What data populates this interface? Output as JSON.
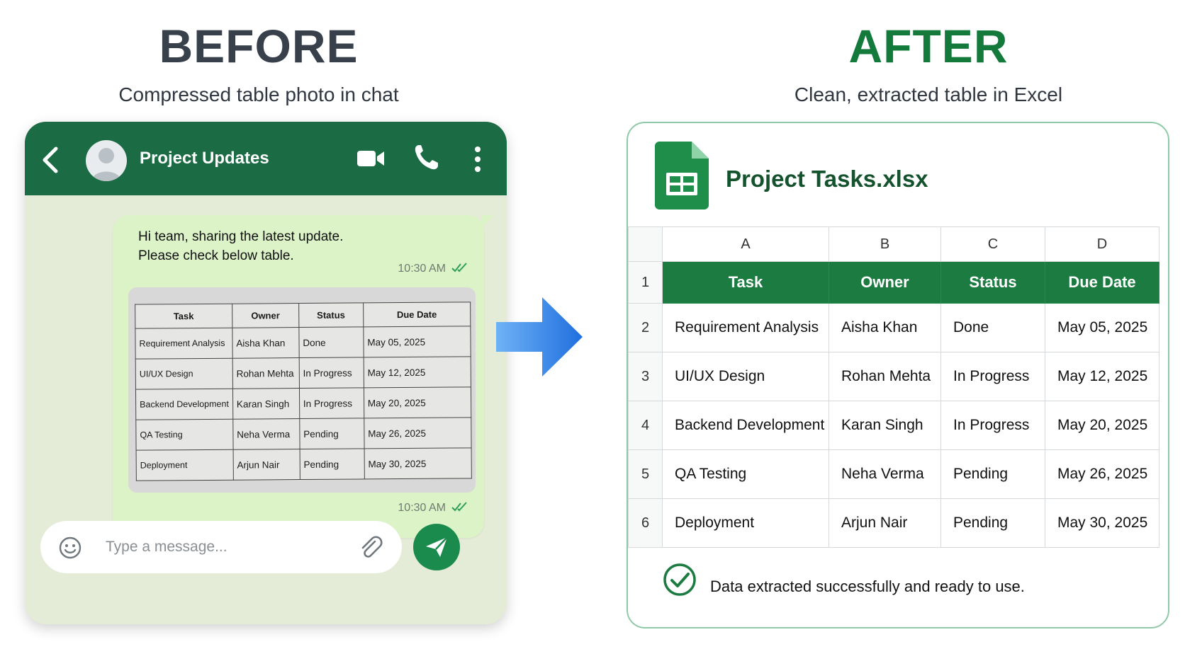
{
  "before": {
    "title": "BEFORE",
    "subtitle": "Compressed table photo in chat"
  },
  "after": {
    "title": "AFTER",
    "subtitle": "Clean, extracted table in Excel"
  },
  "chat": {
    "header_title": "Project Updates",
    "message_lines": [
      "Hi team, sharing the latest update.",
      "Please check below table."
    ],
    "message_time": "10:30 AM",
    "photo_time": "10:30 AM",
    "input_placeholder": "Type a message...",
    "colors": {
      "header": "#1b6b45",
      "bubble": "#dcf3c8",
      "background": "#e4ebd6",
      "send": "#1b8a4d"
    },
    "icons": [
      "back-arrow-icon",
      "avatar-icon",
      "video-call-icon",
      "phone-call-icon",
      "more-vertical-icon",
      "double-check-icon",
      "emoji-icon",
      "paperclip-icon",
      "send-icon"
    ]
  },
  "photo_table": {
    "headers": [
      "Task",
      "Owner",
      "Status",
      "Due Date"
    ],
    "rows": [
      [
        "Requirement Analysis",
        "Aisha Khan",
        "Done",
        "May 05, 2025"
      ],
      [
        "UI/UX Design",
        "Rohan Mehta",
        "In Progress",
        "May 12, 2025"
      ],
      [
        "Backend Development",
        "Karan Singh",
        "In Progress",
        "May 20, 2025"
      ],
      [
        "QA Testing",
        "Neha Verma",
        "Pending",
        "May 26, 2025"
      ],
      [
        "Deployment",
        "Arjun Nair",
        "Pending",
        "May 30, 2025"
      ]
    ]
  },
  "excel": {
    "file_name": "Project Tasks.xlsx",
    "column_letters": [
      "A",
      "B",
      "C",
      "D"
    ],
    "row_numbers": [
      "1",
      "2",
      "3",
      "4",
      "5",
      "6"
    ],
    "headers": [
      "Task",
      "Owner",
      "Status",
      "Due Date"
    ],
    "rows": [
      [
        "Requirement Analysis",
        "Aisha Khan",
        "Done",
        "May 05, 2025"
      ],
      [
        "UI/UX Design",
        "Rohan Mehta",
        "In Progress",
        "May 12, 2025"
      ],
      [
        "Backend Development",
        "Karan Singh",
        "In Progress",
        "May 20, 2025"
      ],
      [
        "QA Testing",
        "Neha Verma",
        "Pending",
        "May 26, 2025"
      ],
      [
        "Deployment",
        "Arjun Nair",
        "Pending",
        "May 30, 2025"
      ]
    ],
    "success_message": "Data extracted successfully and ready to use.",
    "colors": {
      "header_fill": "#1b7b41",
      "file_name": "#14532d",
      "border": "#8fc9a7"
    },
    "icons": [
      "google-sheets-icon",
      "check-circle-icon"
    ]
  },
  "arrow": {
    "icon": "right-arrow-icon",
    "color": "#2f86ea"
  }
}
